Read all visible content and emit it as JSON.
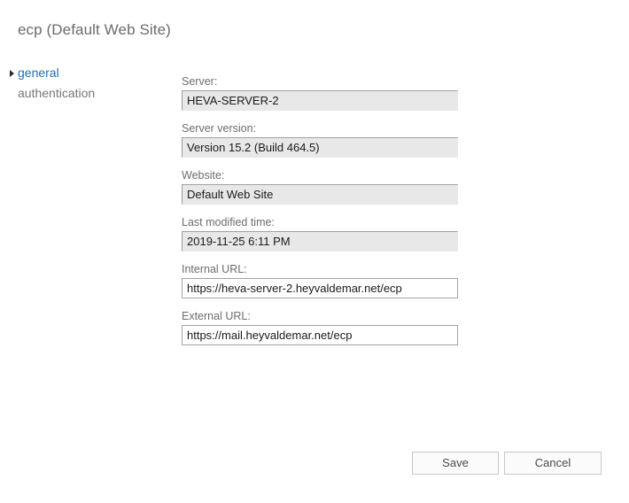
{
  "page": {
    "title": "ecp (Default Web Site)"
  },
  "nav": {
    "items": [
      {
        "label": "general",
        "selected": true,
        "marker": "triangle-right-icon"
      },
      {
        "label": "authentication",
        "selected": false,
        "marker": ""
      }
    ]
  },
  "form": {
    "fields": [
      {
        "name": "server",
        "label": "Server:",
        "value": "HEVA-SERVER-2",
        "readonly": true
      },
      {
        "name": "server-version",
        "label": "Server version:",
        "value": "Version 15.2 (Build 464.5)",
        "readonly": true
      },
      {
        "name": "website",
        "label": "Website:",
        "value": "Default Web Site",
        "readonly": true
      },
      {
        "name": "last-modified-time",
        "label": "Last modified time:",
        "value": "2019-11-25 6:11 PM",
        "readonly": true
      },
      {
        "name": "internal-url",
        "label": "Internal URL:",
        "value": "https://heva-server-2.heyvaldemar.net/ecp",
        "readonly": false
      },
      {
        "name": "external-url",
        "label": "External URL:",
        "value": "https://mail.heyvaldemar.net/ecp",
        "readonly": false
      }
    ]
  },
  "footer": {
    "save_label": "Save",
    "cancel_label": "Cancel"
  },
  "colors": {
    "accent": "#1f6fb5",
    "title": "#6b6b6b",
    "label": "#6d6d6d",
    "readonly_bg": "#e8e8e8",
    "button_bg": "#fbfbfb",
    "button_border": "#c8c8c8"
  }
}
